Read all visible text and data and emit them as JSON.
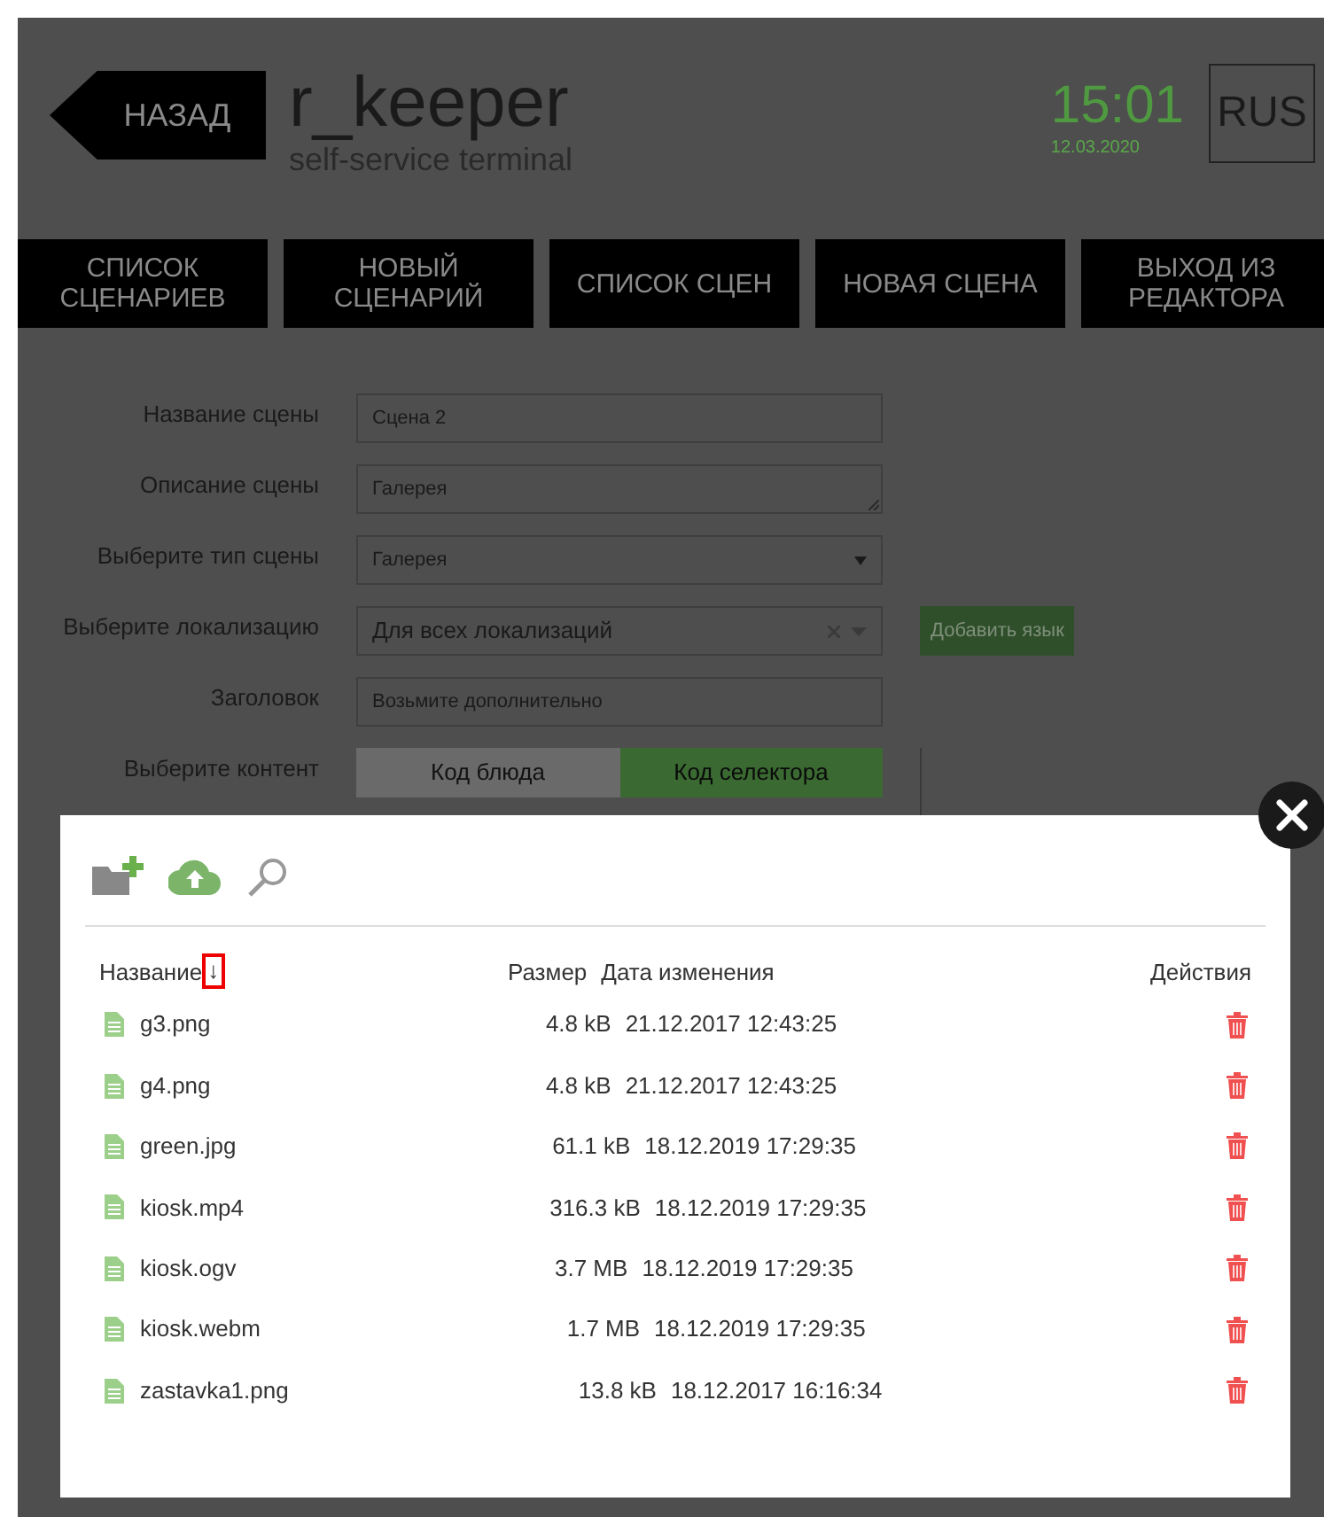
{
  "header": {
    "back_button": "НАЗАД",
    "logo": "r_keeper",
    "logo_subtitle": "self-service terminal",
    "time": "15:01",
    "date": "12.03.2020",
    "language": "RUS"
  },
  "nav": [
    "СПИСОК СЦЕНАРИЕВ",
    "НОВЫЙ СЦЕНАРИЙ",
    "СПИСОК СЦЕН",
    "НОВАЯ СЦЕНА",
    "ВЫХОД ИЗ РЕДАКТОРА"
  ],
  "form": [
    {
      "label": "Название сцены",
      "kind": "input",
      "value": "Сцена 2"
    },
    {
      "label": "Описание сцены",
      "kind": "textarea",
      "value": "Галерея"
    },
    {
      "label": "Выберите тип сцены",
      "kind": "select",
      "value": "Галерея"
    },
    {
      "label": "Выберите локализацию",
      "kind": "multiselect",
      "value": "Для всех локализаций",
      "button": "Добавить язык"
    },
    {
      "label": "Заголовок",
      "kind": "input",
      "value": "Возьмите дополнительно"
    },
    {
      "label": "Выберите контент",
      "kind": "toggle",
      "options": [
        {
          "label": "Код блюда",
          "selected": false
        },
        {
          "label": "Код селектора",
          "selected": true
        }
      ]
    }
  ],
  "file_dialog": {
    "columns": {
      "name": "Название",
      "sort_arrow": "↓",
      "size": "Размер",
      "modified": "Дата изменения",
      "actions": "Действия"
    },
    "rows": [
      {
        "name": "g3.png",
        "size": "4.8 kB",
        "modified": "21.12.2017 12:43:25"
      },
      {
        "name": "g4.png",
        "size": "4.8 kB",
        "modified": "21.12.2017 12:43:25"
      },
      {
        "name": "green.jpg",
        "size": "61.1 kB",
        "modified": "18.12.2019 17:29:35"
      },
      {
        "name": "kiosk.mp4",
        "size": "316.3 kB",
        "modified": "18.12.2019 17:29:35"
      },
      {
        "name": "kiosk.ogv",
        "size": "3.7 MB",
        "modified": "18.12.2019 17:29:35"
      },
      {
        "name": "kiosk.webm",
        "size": "1.7 MB",
        "modified": "18.12.2019 17:29:35"
      },
      {
        "name": "zastavka1.png",
        "size": "13.8 kB",
        "modified": "18.12.2017 16:16:34"
      }
    ]
  }
}
